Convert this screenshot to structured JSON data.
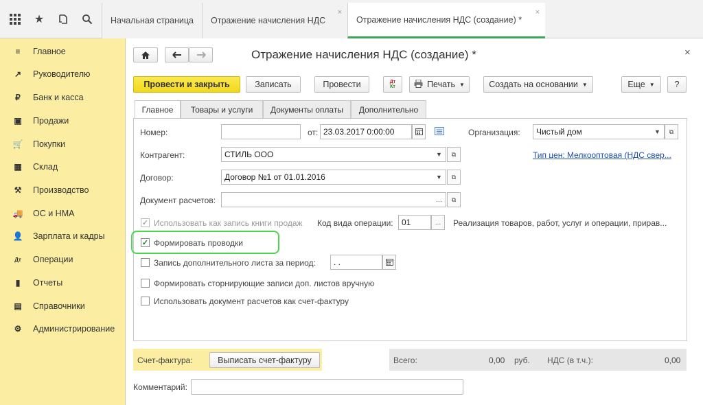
{
  "tabs": [
    {
      "label": "Начальная страница"
    },
    {
      "label": "Отражение начисления НДС",
      "close": "×"
    },
    {
      "label": "Отражение начисления НДС (создание) *",
      "close": "×"
    }
  ],
  "sidebar": {
    "items": [
      {
        "label": "Главное",
        "icon": "≡"
      },
      {
        "label": "Руководителю",
        "icon": "↗"
      },
      {
        "label": "Банк и касса",
        "icon": "₽"
      },
      {
        "label": "Продажи",
        "icon": "▣"
      },
      {
        "label": "Покупки",
        "icon": "🛒"
      },
      {
        "label": "Склад",
        "icon": "▦"
      },
      {
        "label": "Производство",
        "icon": "⚒"
      },
      {
        "label": "ОС и НМА",
        "icon": "🚚"
      },
      {
        "label": "Зарплата и кадры",
        "icon": "👤"
      },
      {
        "label": "Операции",
        "icon": "Дт"
      },
      {
        "label": "Отчеты",
        "icon": "▮"
      },
      {
        "label": "Справочники",
        "icon": "▤"
      },
      {
        "label": "Администрирование",
        "icon": "⚙"
      }
    ]
  },
  "form": {
    "title": "Отражение начисления НДС (создание) *",
    "close": "×",
    "toolbar": {
      "post_close": "Провести и закрыть",
      "save": "Записать",
      "post": "Провести",
      "print": "Печать",
      "create_based": "Создать на основании",
      "more": "Еще",
      "help": "?"
    },
    "form_tabs": [
      "Главное",
      "Товары и услуги",
      "Документы оплаты",
      "Дополнительно"
    ],
    "fields": {
      "number_label": "Номер:",
      "number_value": "",
      "date_label": "от:",
      "date_value": "23.03.2017  0:00:00",
      "org_label": "Организация:",
      "org_value": "Чистый дом",
      "counterparty_label": "Контрагент:",
      "counterparty_value": "СТИЛЬ ООО",
      "price_type_link": "Тип цен: Мелкооптовая (НДС свер...",
      "contract_label": "Договор:",
      "contract_value": "Договор №1 от 01.01.2016",
      "settlement_doc_label": "Документ расчетов:",
      "settlement_doc_value": "",
      "use_as_sales_book": "Использовать как запись книги продаж",
      "op_code_label": "Код вида операции:",
      "op_code_value": "01",
      "op_code_desc": "Реализация товаров, работ, услуг и операции, прирав...",
      "form_entries": "Формировать проводки",
      "additional_sheet": "Запись дополнительного листа за период:",
      "additional_sheet_value": " .  .",
      "storno": "Формировать сторнирующие записи доп. листов вручную",
      "use_doc_as_invoice": "Использовать документ расчетов как счет-фактуру"
    },
    "footer": {
      "invoice_label": "Счет-фактура:",
      "issue_invoice": "Выписать счет-фактуру",
      "total_label": "Всего:",
      "total_value": "0,00",
      "currency": "руб.",
      "vat_label": "НДС (в т.ч.):",
      "vat_value": "0,00",
      "comment_label": "Комментарий:",
      "comment_value": ""
    }
  },
  "colors": {
    "accent_green": "#3aa655",
    "sidebar": "#fbeda1",
    "primary_button": "#f2d81c",
    "link": "#1f4fa8"
  }
}
